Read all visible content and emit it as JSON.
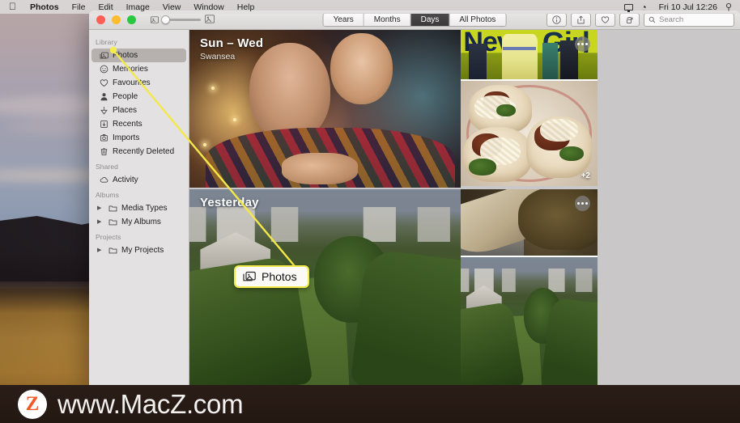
{
  "menubar": {
    "apple_icon": "apple-icon",
    "items": [
      {
        "label": "Photos",
        "bold": true
      },
      {
        "label": "File",
        "bold": false
      },
      {
        "label": "Edit",
        "bold": false
      },
      {
        "label": "Image",
        "bold": false
      },
      {
        "label": "View",
        "bold": false
      },
      {
        "label": "Window",
        "bold": false
      },
      {
        "label": "Help",
        "bold": false
      }
    ],
    "status": {
      "screen_icon": "display-icon",
      "siri_icon": "siri-icon",
      "clock": "Fri 10 Jul  12:26",
      "search_icon": "spotlight-search-icon"
    }
  },
  "window": {
    "traffic_lights": {
      "close": "close-button",
      "minimize": "minimize-button",
      "zoom": "maximize-button"
    },
    "zoom_slider": {
      "small_icon": "small-thumbnails-icon",
      "large_icon": "large-thumbnails-icon",
      "value": 8
    },
    "segments": [
      {
        "label": "Years",
        "active": false
      },
      {
        "label": "Months",
        "active": false
      },
      {
        "label": "Days",
        "active": true
      },
      {
        "label": "All Photos",
        "active": false
      }
    ],
    "toolbar_buttons": [
      {
        "name": "info-button",
        "icon": "info-icon"
      },
      {
        "name": "share-button",
        "icon": "share-icon"
      },
      {
        "name": "favorite-button",
        "icon": "heart-icon"
      },
      {
        "name": "rotate-button",
        "icon": "rotate-icon"
      }
    ],
    "search": {
      "placeholder": "Search",
      "value": "",
      "icon": "search-icon"
    }
  },
  "sidebar": {
    "sections": [
      {
        "title": "Library",
        "items": [
          {
            "label": "Photos",
            "icon": "photos-icon",
            "selected": true,
            "disclosure": false
          },
          {
            "label": "Memories",
            "icon": "memories-icon",
            "selected": false,
            "disclosure": false
          },
          {
            "label": "Favourites",
            "icon": "heart-icon",
            "selected": false,
            "disclosure": false
          },
          {
            "label": "People",
            "icon": "person-icon",
            "selected": false,
            "disclosure": false
          },
          {
            "label": "Places",
            "icon": "pin-icon",
            "selected": false,
            "disclosure": false
          },
          {
            "label": "Recents",
            "icon": "recents-icon",
            "selected": false,
            "disclosure": false
          },
          {
            "label": "Imports",
            "icon": "imports-icon",
            "selected": false,
            "disclosure": false
          },
          {
            "label": "Recently Deleted",
            "icon": "trash-icon",
            "selected": false,
            "disclosure": false
          }
        ]
      },
      {
        "title": "Shared",
        "items": [
          {
            "label": "Activity",
            "icon": "cloud-icon",
            "selected": false,
            "disclosure": false
          }
        ]
      },
      {
        "title": "Albums",
        "items": [
          {
            "label": "Media Types",
            "icon": "folder-icon",
            "selected": false,
            "disclosure": true
          },
          {
            "label": "My Albums",
            "icon": "folder-icon",
            "selected": false,
            "disclosure": true
          }
        ]
      },
      {
        "title": "Projects",
        "items": [
          {
            "label": "My Projects",
            "icon": "folder-icon",
            "selected": false,
            "disclosure": true
          }
        ]
      }
    ]
  },
  "content": {
    "days": [
      {
        "title": "Sun – Wed",
        "subtitle": "Swansea",
        "more_button": "more-options-button",
        "stack_badge": "+2"
      },
      {
        "title": "Yesterday",
        "subtitle": "",
        "more_button": "more-options-button",
        "stack_badge": ""
      }
    ]
  },
  "callout": {
    "label": "Photos",
    "icon": "photos-icon",
    "border_color": "#f2e84a"
  },
  "watermark": {
    "badge_letter": "Z",
    "text": "www.MacZ.com",
    "accent_color": "#f05a28"
  }
}
